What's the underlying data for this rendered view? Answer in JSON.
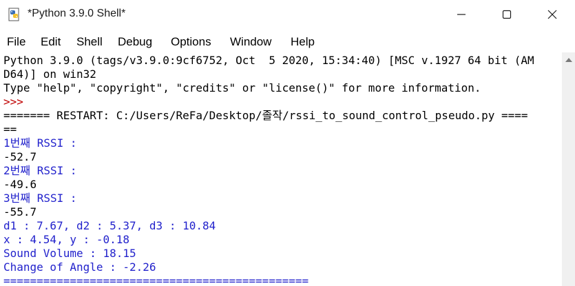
{
  "window": {
    "title": "*Python 3.9.0 Shell*"
  },
  "menu": {
    "items": [
      "File",
      "Edit",
      "Shell",
      "Debug",
      "Options",
      "Window",
      "Help"
    ]
  },
  "shell": {
    "lines": [
      "Python 3.9.0 (tags/v3.9.0:9cf6752, Oct  5 2020, 15:34:40) [MSC v.1927 64 bit (AM",
      "D64)] on win32",
      "Type \"help\", \"copyright\", \"credits\" or \"license()\" for more information.",
      ">>> ",
      "======= RESTART: C:/Users/ReFa/Desktop/졸작/rssi_to_sound_control_pseudo.py ====",
      "==",
      "1번째 RSSI :",
      "-52.7",
      "2번째 RSSI :",
      "-49.6",
      "3번째 RSSI :",
      "-55.7",
      "d1 : 7.67, d2 : 5.37, d3 : 10.84",
      "x : 4.54, y : -0.18",
      "Sound Volume : 18.15",
      "Change of Angle : -2.26",
      "=============================================="
    ]
  },
  "colors": {
    "output_blue": "#2222cc",
    "prompt_red": "#c00000",
    "text_black": "#000000"
  },
  "icons": {
    "app": "python-idle-icon",
    "minimize": "minimize-icon",
    "maximize": "maximize-icon",
    "close": "close-icon",
    "scroll_up": "scroll-up-arrow-icon"
  }
}
